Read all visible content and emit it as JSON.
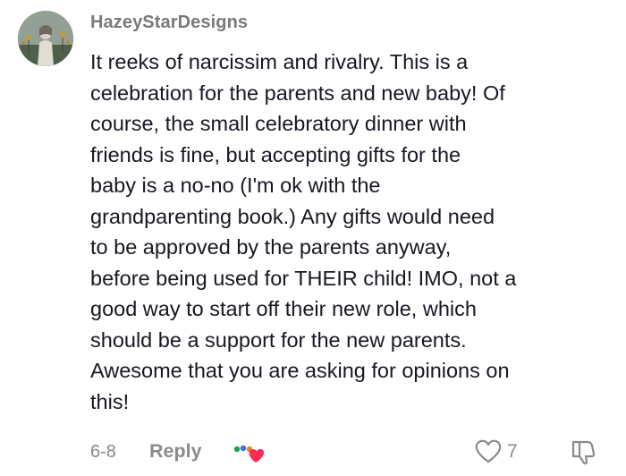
{
  "comment": {
    "username": "HazeyStarDesigns",
    "text": "It reeks of narcissim and rivalry. This is a\ncelebration for the parents and new baby! Of\ncourse, the small celebratory dinner with\nfriends is fine, but accepting gifts for the\nbaby is a no-no (I'm ok with the\ngrandparenting book.) Any gifts would need\nto be approved by the parents anyway,\nbefore being used for THEIR child! IMO, not a\ngood way to start off their new role, which\nshould be a support for the new parents.\nAwesome that you are asking for opinions on\nthis!",
    "date": "6-8",
    "reply_label": "Reply",
    "like_count": "7"
  },
  "icons": {
    "avatar": "avatar-image",
    "reactions": "creator-reaction-icon",
    "like": "heart-outline-icon",
    "dislike": "thumbs-down-icon"
  },
  "colors": {
    "username": "#7a7a7a",
    "text": "#161823",
    "meta": "#8a8a8a",
    "heart_red": "#fe2c55"
  }
}
